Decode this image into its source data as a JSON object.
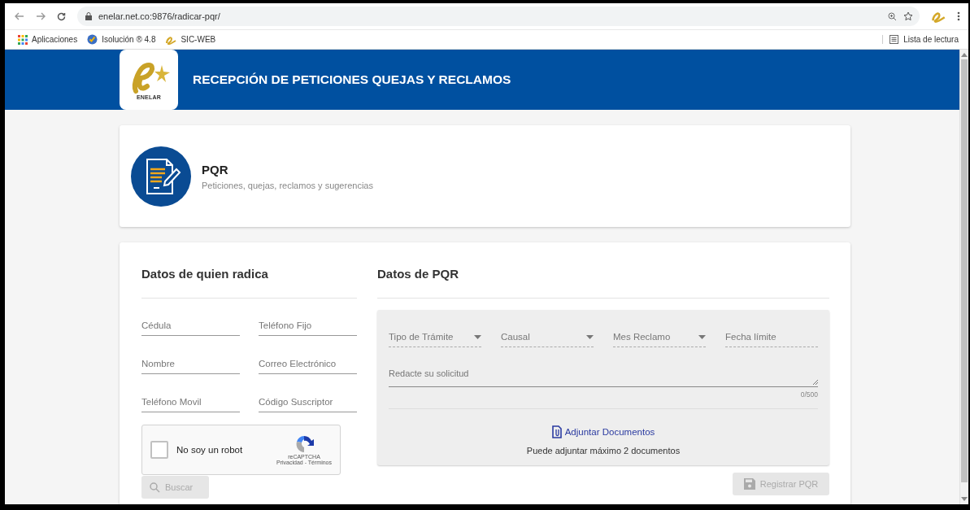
{
  "browser": {
    "url": "enelar.net.co:9876/radicar-pqr/",
    "bookmarks": [
      {
        "label": "Aplicaciones",
        "kind": "apps"
      },
      {
        "label": "Isolución ® 4.8",
        "kind": "check"
      },
      {
        "label": "SIC-WEB",
        "kind": "logo"
      }
    ],
    "reading_list": "Lista de lectura"
  },
  "header": {
    "logo_text": "ENELAR",
    "title": "RECEPCIÓN DE PETICIONES QUEJAS Y RECLAMOS"
  },
  "intro": {
    "title": "PQR",
    "subtitle": "Peticiones, quejas, reclamos y sugerencias"
  },
  "requester": {
    "heading": "Datos de quien radica",
    "fields": [
      {
        "placeholder": "Cédula"
      },
      {
        "placeholder": "Teléfono Fijo"
      },
      {
        "placeholder": "Nombre"
      },
      {
        "placeholder": "Correo Electrónico"
      },
      {
        "placeholder": "Teléfono Movil"
      },
      {
        "placeholder": "Código Suscriptor"
      }
    ],
    "captcha": {
      "label": "No soy un robot",
      "checked": false,
      "brand": "reCAPTCHA",
      "links": "Privacidad - Términos"
    },
    "search_button": {
      "label": "Buscar",
      "disabled": true
    }
  },
  "pqr": {
    "heading": "Datos de PQR",
    "fields": [
      {
        "placeholder": "Tipo de Trámite",
        "kind": "select"
      },
      {
        "placeholder": "Causal",
        "kind": "select"
      },
      {
        "placeholder": "Mes Reclamo",
        "kind": "select"
      },
      {
        "placeholder": "Fecha límite",
        "kind": "date"
      }
    ],
    "request": {
      "placeholder": "Redacte su solicitud",
      "counter": "0/500"
    },
    "attach_link": "Adjuntar Documentos",
    "attach_note": "Puede adjuntar máximo 2 documentos",
    "submit_button": {
      "label": "Registrar PQR",
      "disabled": true
    }
  }
}
